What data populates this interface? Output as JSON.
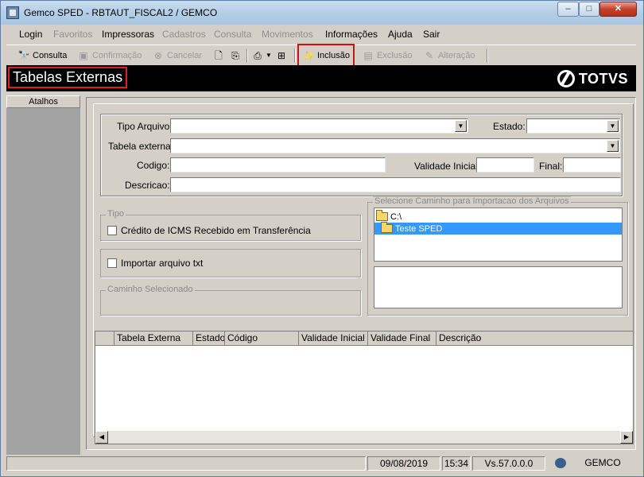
{
  "window": {
    "title": "Gemco SPED - RBTAUT_FISCAL2 / GEMCO",
    "controls": {
      "minimize": "–",
      "maximize": "□",
      "close": "✕"
    }
  },
  "menu": [
    {
      "label": "Login",
      "enabled": true
    },
    {
      "label": "Favoritos",
      "enabled": false
    },
    {
      "label": "Impressoras",
      "enabled": true
    },
    {
      "label": "Cadastros",
      "enabled": false
    },
    {
      "label": "Consulta",
      "enabled": false
    },
    {
      "label": "Movimentos",
      "enabled": false
    },
    {
      "label": "Informações",
      "enabled": true
    },
    {
      "label": "Ajuda",
      "enabled": true
    },
    {
      "label": "Sair",
      "enabled": true
    }
  ],
  "toolbar": {
    "consulta": "Consulta",
    "confirmacao": "Confirmação",
    "cancelar": "Cancelar",
    "inclusao": "Inclusão",
    "exclusao": "Exclusão",
    "alteracao": "Alteração"
  },
  "banner": {
    "title": "Tabelas Externas",
    "logo": "TOTVS"
  },
  "sidebar": {
    "header": "Atalhos"
  },
  "form": {
    "tipo_arquivo_label": "Tipo Arquivo:",
    "tipo_arquivo_value": "",
    "estado_label": "Estado:",
    "estado_value": "",
    "tabela_externa_label": "Tabela externa:",
    "tabela_externa_value": "",
    "codigo_label": "Codigo:",
    "codigo_value": "",
    "validade_inicial_label": "Validade Inicial:",
    "validade_inicial_value": "",
    "final_label": "Final:",
    "final_value": "",
    "descricao_label": "Descricao:",
    "descricao_value": ""
  },
  "tipo_group": {
    "title": "Tipo",
    "checkbox_label": "Crédito de ICMS Recebido em Transferência",
    "checked": false
  },
  "importar": {
    "checkbox_label": "Importar  arquivo  txt",
    "checked": false
  },
  "caminho_group": {
    "title": "Caminho Selecionado"
  },
  "import_path": {
    "title": "Selecione Caminho  para Importacao dos Arquivos",
    "tree": [
      {
        "label": "C:\\",
        "selected": false
      },
      {
        "label": "Teste SPED",
        "selected": true
      }
    ]
  },
  "grid": {
    "columns": [
      "",
      "Tabela Externa",
      "Estado",
      "Código",
      "Validade Inicial",
      "Validade Final",
      "Descrição"
    ],
    "rows": []
  },
  "status": {
    "date": "09/08/2019",
    "time": "15:34",
    "version": "Vs.57.0.0.0",
    "user": "GEMCO"
  },
  "colors": {
    "highlight": "#d01010",
    "selection": "#3399ff",
    "banner_bg": "#000000"
  }
}
